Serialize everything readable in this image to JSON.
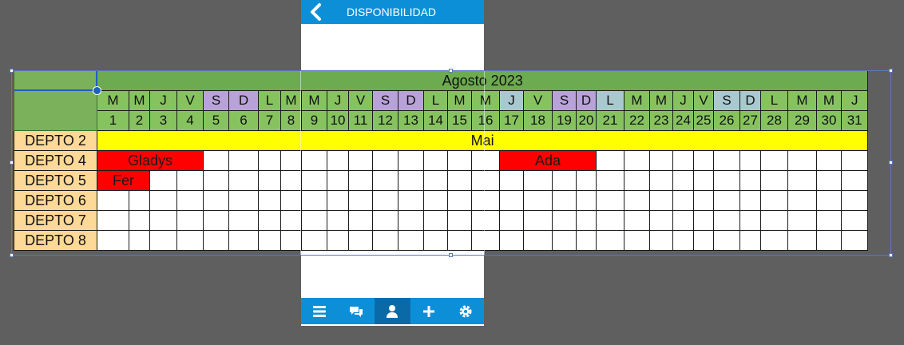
{
  "phone": {
    "title": "DISPONIBILIDAD",
    "tabs": [
      {
        "name": "menu-icon"
      },
      {
        "name": "chat-icon"
      },
      {
        "name": "user-icon",
        "active": true
      },
      {
        "name": "plus-icon"
      },
      {
        "name": "gear-icon"
      }
    ],
    "header_color": "#0d8fd8"
  },
  "sheet": {
    "month": "Agosto 2023",
    "weekdays": [
      "M",
      "M",
      "J",
      "V",
      "S",
      "D",
      "L",
      "M",
      "M",
      "J",
      "V",
      "S",
      "D",
      "L",
      "M",
      "M",
      "J",
      "V",
      "S",
      "D",
      "L",
      "M",
      "M",
      "J",
      "V",
      "S",
      "D",
      "L",
      "M",
      "M",
      "J"
    ],
    "dates": [
      "1",
      "2",
      "3",
      "4",
      "5",
      "6",
      "7",
      "8",
      "9",
      "10",
      "11",
      "12",
      "13",
      "14",
      "15",
      "16",
      "17",
      "18",
      "19",
      "20",
      "21",
      "22",
      "23",
      "24",
      "25",
      "26",
      "27",
      "28",
      "29",
      "30",
      "31"
    ],
    "rows": [
      {
        "label": "DEPTO 2",
        "bookings": [
          {
            "start": 1,
            "end": 31,
            "name": "Mai",
            "color": "yellow"
          }
        ]
      },
      {
        "label": "DEPTO 4",
        "bookings": [
          {
            "start": 1,
            "end": 4,
            "name": "Gladys",
            "color": "red"
          },
          {
            "start": 17,
            "end": 20,
            "name": "Ada",
            "color": "red"
          }
        ]
      },
      {
        "label": "DEPTO 5",
        "bookings": [
          {
            "start": 1,
            "end": 2,
            "name": "Fer",
            "color": "red"
          }
        ]
      },
      {
        "label": "DEPTO 6",
        "bookings": []
      },
      {
        "label": "DEPTO 7",
        "bookings": []
      },
      {
        "label": "DEPTO 8",
        "bookings": []
      }
    ],
    "colors": {
      "month": "#6cab4f",
      "day": "#86c35f",
      "weekend_a": "#b9a2d8",
      "weekend_b": "#a9c9cf",
      "label": "#fdd998",
      "booked_red": "#ff0000",
      "booked_yellow": "#ffff00"
    }
  }
}
